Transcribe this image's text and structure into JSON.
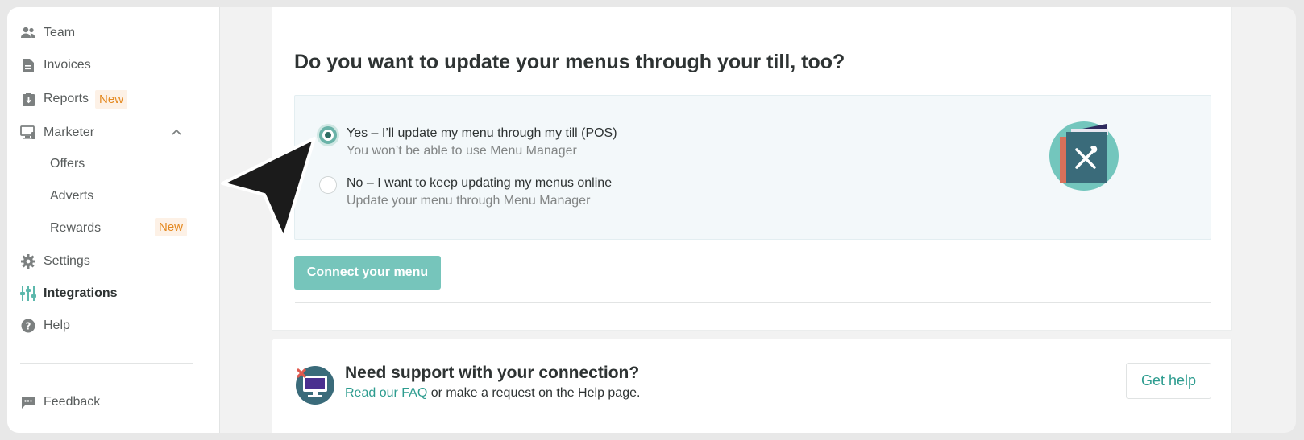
{
  "sidebar": {
    "items": [
      {
        "label": "Team",
        "icon": "team-icon"
      },
      {
        "label": "Invoices",
        "icon": "invoice-icon"
      },
      {
        "label": "Reports",
        "icon": "reports-icon",
        "badge": "New"
      },
      {
        "label": "Marketer",
        "icon": "marketer-icon"
      },
      {
        "label": "Settings",
        "icon": "gear-icon"
      },
      {
        "label": "Integrations",
        "icon": "integrations-icon"
      },
      {
        "label": "Help",
        "icon": "help-icon"
      },
      {
        "label": "Feedback",
        "icon": "feedback-icon"
      }
    ],
    "marketer_sub": [
      {
        "label": "Offers"
      },
      {
        "label": "Adverts"
      },
      {
        "label": "Rewards",
        "badge": "New"
      }
    ]
  },
  "main": {
    "question": "Do you want to update your menus through your till, too?",
    "options": [
      {
        "title": "Yes – I’ll update my menu through my till (POS)",
        "subtitle": "You won’t be able to use Menu Manager",
        "checked": true
      },
      {
        "title": "No – I want to keep updating my menus online",
        "subtitle": "Update your menu through Menu Manager",
        "checked": false
      }
    ],
    "connect_label": "Connect your menu"
  },
  "support": {
    "title": "Need support with your connection?",
    "faq_link": "Read our FAQ",
    "desc_rest": " or make a request on the Help page.",
    "help_button": "Get help"
  },
  "colors": {
    "accent": "#76c5bb",
    "link": "#2d9c8f",
    "badge_text": "#e48a22",
    "badge_bg": "#fdf1e6"
  }
}
